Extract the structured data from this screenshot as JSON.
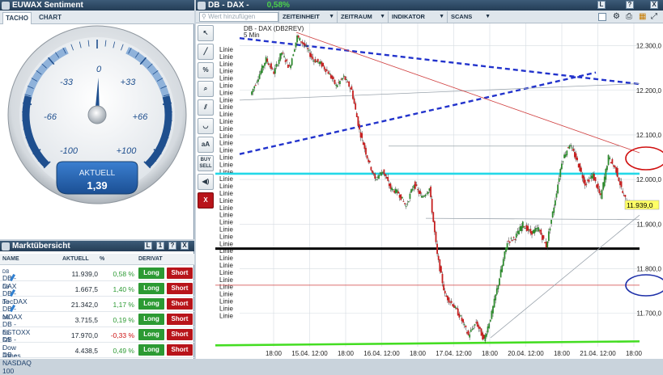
{
  "sentiment": {
    "title": "EUWAX Sentiment",
    "tabs": [
      "TACHO",
      "CHART"
    ],
    "gauge_labels": {
      "zero": "0",
      "m33": "-33",
      "p33": "+33",
      "m66": "-66",
      "p66": "+66",
      "m100": "-100",
      "p100": "+100"
    },
    "aktuell_label": "AKTUELL",
    "aktuell_value": "1,39",
    "value": 1.39,
    "colors": {
      "accent": "#1f4f8e",
      "plate": "#2868b8"
    }
  },
  "markt": {
    "title": "Marktübersicht",
    "window_buttons": [
      "L",
      "1",
      "?",
      "X"
    ],
    "columns": {
      "name": "NAME",
      "aktuell": "AKTUELL",
      "pct": "%",
      "derivat": "DERIVAT"
    },
    "long_label": "Long",
    "short_label": "Short",
    "rows": [
      {
        "name": "DB - DAX",
        "sup": "DB",
        "pen": true,
        "price": "11.939,0",
        "pct": "0,58 %",
        "pos": true
      },
      {
        "name": "DB - TecDAX",
        "sup": "DB",
        "pen": true,
        "price": "1.667,5",
        "pct": "1,40 %",
        "pos": true
      },
      {
        "name": "DB - MDAX",
        "sup": "DB",
        "pen": true,
        "price": "21.342,0",
        "pct": "1,17 %",
        "pos": true
      },
      {
        "name": "DB - ESTOXX 50",
        "sup": "DB",
        "pen": false,
        "price": "3.715,5",
        "pct": "0,19 %",
        "pos": true
      },
      {
        "name": "DB - Dow Jones",
        "sup": "DB",
        "pen": false,
        "price": "17.970,0",
        "pct": "-0,33 %",
        "pos": false
      },
      {
        "name": "DB - NASDAQ 100",
        "sup": "I",
        "pen": false,
        "price": "4.438,5",
        "pct": "0,49 %",
        "pos": true
      }
    ]
  },
  "chartwin": {
    "title": "DB - DAX -",
    "pct": "0,58%",
    "search_placeholder": "Wert hinzufügen",
    "menus": [
      "ZEITEINHEIT",
      "ZEITRAUM",
      "INDIKATOR",
      "SCANS"
    ],
    "instrument_label": "DB - DAX (DB2REV)",
    "interval_label": "5 Min",
    "tools": [
      "cursor-icon",
      "line-icon",
      "percent-icon",
      "zoom-icon",
      "parallel-icon",
      "curve-icon",
      "text-size-icon",
      "buy-sell-icon",
      "sound-icon",
      "close-icon"
    ],
    "tool_labels": {
      "aa": "aA",
      "buysell": "BUY SELL",
      "close": "X"
    },
    "line_label": "Linie",
    "price_tag": "11.939,0"
  },
  "chart_data": {
    "type": "line",
    "series": [
      {
        "values": [
          12190,
          12230,
          12270,
          12240,
          12285,
          12250,
          12320,
          12300,
          12270,
          12260,
          12240,
          12210,
          12230,
          12200,
          12110,
          12050,
          12000,
          12020,
          11980,
          11970,
          11940,
          11990,
          11960,
          11980,
          11830,
          11740,
          11720,
          11690,
          11650,
          11680,
          11640,
          11700,
          11780,
          11860,
          11870,
          11900,
          11880,
          11890,
          11850,
          11940,
          12040,
          12080,
          12040,
          11990,
          12010,
          11960,
          12050,
          12020,
          11960,
          11939
        ]
      }
    ],
    "x_tick_labels": [
      "18:00",
      "15.04. 12:00",
      "18:00",
      "16.04. 12:00",
      "18:00",
      "17.04. 12:00",
      "18:00",
      "20.04. 12:00",
      "18:00",
      "21.04. 12:00",
      "18:00"
    ],
    "y_tick_labels": [
      "12.300,0",
      "12.200,0",
      "12.100,0",
      "12.000,0",
      "11.900,0",
      "11.800,0",
      "11.700,0"
    ],
    "ylim": [
      11625,
      12350
    ],
    "last_value": "11.939,0",
    "grid": true
  }
}
